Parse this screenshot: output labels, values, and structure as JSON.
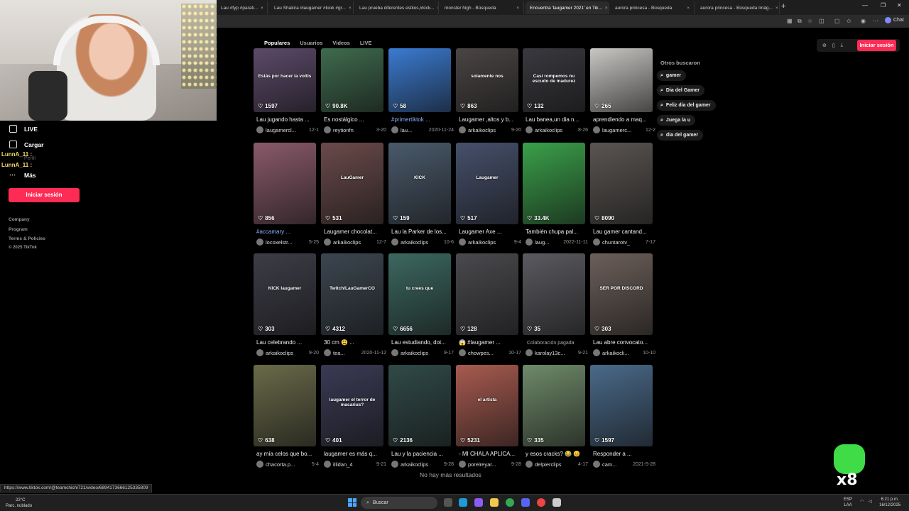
{
  "browser": {
    "tabs": [
      {
        "label": "Lau #fyp #parati..."
      },
      {
        "label": "Lau Shakira #laugamer #look #gr..."
      },
      {
        "label": "Lau prueba diferentes estilos,#kick..."
      },
      {
        "label": "monster high - Búsqueda"
      },
      {
        "label": "Encuentra 'laugamer 2021' en Tik..."
      },
      {
        "label": "aurora princesa - Búsqueda"
      },
      {
        "label": "aurora princesa - Búsqueda Imág..."
      }
    ],
    "new_tab": "+",
    "chat_label": "Chat"
  },
  "sidebar": {
    "items": [
      {
        "label": "LIVE",
        "icon": "live-icon"
      },
      {
        "label": "Cargar",
        "icon": "upload-icon"
      },
      {
        "label": "Más",
        "icon": "more-icon"
      }
    ],
    "chat_lines": [
      "LunnA_11 :",
      "LunnA_11 :"
    ],
    "perfil_ghost": "Perfil",
    "login_label": "Iniciar sesión",
    "footer_links": [
      "Company",
      "Program",
      "Terms & Policies"
    ],
    "copyright": "© 2025 TikTok"
  },
  "main": {
    "tabs": [
      "Populares",
      "Usuarios",
      "Videos",
      "LIVE"
    ],
    "selected_tab": "Populares",
    "login_label": "Iniciar sesión",
    "others_title": "Otros buscaron",
    "others": [
      "gamer",
      "Dia del Gamer",
      "Feliz dia del gamer",
      "Juega la u",
      "dia del gamer"
    ],
    "no_more": "No hay más resultados",
    "cards": [
      {
        "likes": "1597",
        "title": "Lau jugando hasta ...",
        "user": "laugamercl...",
        "date": "12-1",
        "overlay": "Estás por hacer la voltis",
        "color": "#5c4a6a"
      },
      {
        "likes": "90.8K",
        "title": "Es nostálgico ...",
        "user": "reytionfn",
        "date": "3-20",
        "overlay": "",
        "color": "#3f6b4d"
      },
      {
        "likes": "58",
        "title": "#primertiktok ...",
        "user": "lau...",
        "date": "2020-11-24",
        "overlay": "",
        "color": "#3b7bd1",
        "hl": true
      },
      {
        "likes": "863",
        "title": "Laugamer ,altos y b...",
        "user": "arkaikoclips",
        "date": "9-20",
        "overlay": "solamente nos",
        "color": "#4b4545"
      },
      {
        "likes": "132",
        "title": "Lau banea,un dia n...",
        "user": "arkaikoclips",
        "date": "8-26",
        "overlay": "Casi rompemos nu escudo de madurez",
        "color": "#39393f"
      },
      {
        "likes": "265",
        "title": "aprendiendo a maq...",
        "user": "laugamerc...",
        "date": "12-2",
        "overlay": "",
        "color": "#c9c7c4"
      },
      {
        "likes": "856",
        "title": "#accamary ...",
        "user": "locoxelstr...",
        "date": "5-25",
        "overlay": "",
        "color": "#8a5a6a",
        "hl": true
      },
      {
        "likes": "531",
        "title": "Laugamer chocolat...",
        "user": "arkaikoclips",
        "date": "12-7",
        "overlay": "LauGamer",
        "color": "#6b4a4a"
      },
      {
        "likes": "159",
        "title": "Lau la Parker de los...",
        "user": "arkaikoclips",
        "date": "10-6",
        "overlay": "KICK",
        "color": "#4a5a6b"
      },
      {
        "likes": "517",
        "title": "Laugamer Axe ...",
        "user": "arkaikoclips",
        "date": "9-4",
        "overlay": "Laugamer",
        "color": "#46506b"
      },
      {
        "likes": "33.4K",
        "title": "También chupa pal...",
        "user": "laug...",
        "date": "2022-11-11",
        "overlay": "",
        "color": "#3aa04a"
      },
      {
        "likes": "8090",
        "title": "Lau gamer cantand...",
        "user": "chuntarotv_",
        "date": "7-17",
        "overlay": "",
        "color": "#5a5552"
      },
      {
        "likes": "303",
        "title": "Lau celebrando ...",
        "user": "arkaikoclips",
        "date": "9-20",
        "overlay": "KICK laugamer",
        "color": "#3d3d48"
      },
      {
        "likes": "4312",
        "title": "30 cm 😩 ...",
        "user": "tea...",
        "date": "2020-11-12",
        "overlay": "Twitch/LauGamerCO",
        "color": "#3c4650"
      },
      {
        "likes": "6656",
        "title": "Lau estudiando, dot...",
        "user": "arkaikoclips",
        "date": "9-17",
        "overlay": "tu crees que",
        "color": "#3c6860"
      },
      {
        "likes": "128",
        "title": "😱 #laugamer ...",
        "user": "chowpes...",
        "date": "10-17",
        "overlay": "",
        "color": "#4a4a4e"
      },
      {
        "likes": "35",
        "title": "",
        "user": "karolay13c...",
        "date": "9-21",
        "overlay": "",
        "color": "#5b5a60",
        "collab": "Colaboración pagada"
      },
      {
        "likes": "303",
        "title": "Lau abre convocato...",
        "user": "arkaikocli...",
        "date": "10-10",
        "overlay": "SER POR DISCORD",
        "color": "#6c5f5a"
      },
      {
        "likes": "638",
        "title": "ay mía celos que bo...",
        "user": "chacorta.p...",
        "date": "5-4",
        "overlay": "",
        "color": "#6a6a4a"
      },
      {
        "likes": "401",
        "title": "laugamer es más q...",
        "user": "illidan_4",
        "date": "9-21",
        "overlay": "laugamer el terror de macarius?",
        "color": "#3a3a55"
      },
      {
        "likes": "2136",
        "title": "Lau y la paciencia ...",
        "user": "arkaikoclips",
        "date": "9-28",
        "overlay": "",
        "color": "#304a48"
      },
      {
        "likes": "5231",
        "title": "- MI CHALA APLICA...",
        "user": "porelreyar...",
        "date": "9-28",
        "overlay": "el artista",
        "color": "#a85b50"
      },
      {
        "likes": "335",
        "title": "y esos cracks? 😂 😊",
        "user": "delpierclips",
        "date": "4-17",
        "overlay": "",
        "color": "#6f8a6a"
      },
      {
        "likes": "1597",
        "title": "Responder a ...",
        "user": "cam...",
        "date": "2021-5-28",
        "overlay": "",
        "color": "#4a6a8a"
      }
    ]
  },
  "status_url": "https://www.tiktok.com/@teamchichi721/video/6894173666125335809",
  "overlay_text": "x8",
  "taskbar": {
    "weather_temp": "22°C",
    "weather_desc": "Parc. nublado",
    "search_label": "Buscar",
    "lang_top": "ESP",
    "lang_bottom": "LAA",
    "time": "6:21 p.m.",
    "date": "16/12/2025"
  },
  "colors": {
    "accent": "#fe2c55",
    "link": "#8ab4ff"
  }
}
